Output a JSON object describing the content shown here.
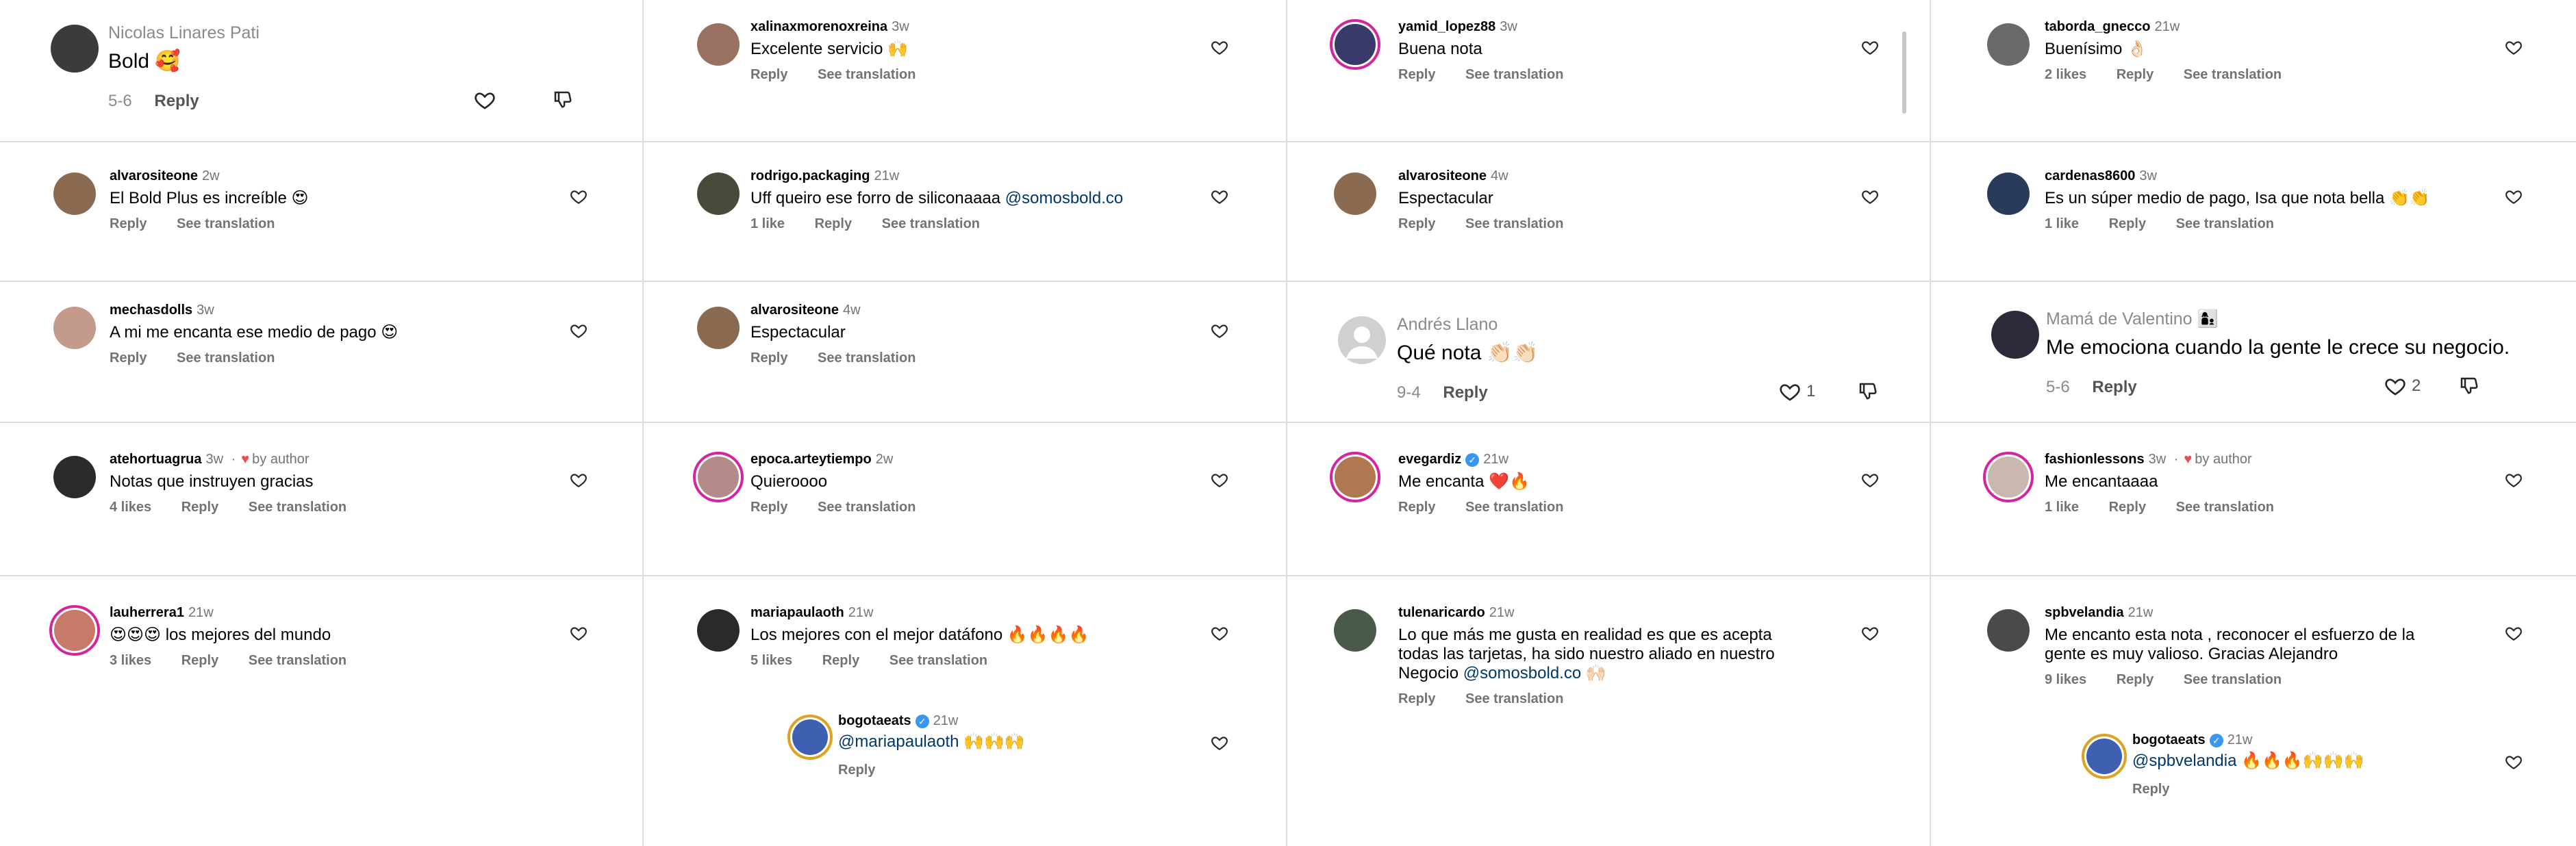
{
  "columns": [
    {
      "comments": [
        {
          "type": "tiktok",
          "name": "Nicolas Linares Pati",
          "text": "Bold 🥰",
          "date": "5-6",
          "reply": "Reply",
          "likes": ""
        },
        {
          "type": "ig",
          "user": "alvarositeone",
          "time": "2w",
          "text": "El Bold Plus es increíble 😍",
          "likes": "",
          "reply": "Reply",
          "translate": "See translation"
        },
        {
          "type": "ig",
          "user": "mechasdolls",
          "time": "3w",
          "text": "A mi me encanta ese medio de pago 😍",
          "likes": "",
          "reply": "Reply",
          "translate": "See translation"
        },
        {
          "type": "ig",
          "user": "atehortuagrua",
          "time": "3w",
          "by_author": "by author",
          "text": "Notas que instruyen gracias",
          "likes": "4 likes",
          "reply": "Reply",
          "translate": "See translation"
        },
        {
          "type": "ig",
          "user": "lauherrera1",
          "time": "21w",
          "text": "😍😍😍 los mejores del mundo",
          "likes": "3 likes",
          "reply": "Reply",
          "translate": "See translation"
        }
      ]
    },
    {
      "comments": [
        {
          "type": "ig",
          "user": "xalinaxmorenoxreina",
          "time": "3w",
          "text": "Excelente servicio 🙌",
          "likes": "",
          "reply": "Reply",
          "translate": "See translation"
        },
        {
          "type": "ig",
          "user": "rodrigo.packaging",
          "time": "21w",
          "text": "Uff queiro ese forro de siliconaaaa",
          "mention": "@somosbold.co",
          "likes": "1 like",
          "reply": "Reply",
          "translate": "See translation"
        },
        {
          "type": "ig",
          "user": "alvarositeone",
          "time": "4w",
          "text": "Espectacular",
          "likes": "",
          "reply": "Reply",
          "translate": "See translation"
        },
        {
          "type": "ig",
          "user": "epoca.arteytiempo",
          "time": "2w",
          "text": "Quieroooo",
          "likes": "",
          "reply": "Reply",
          "translate": "See translation"
        },
        {
          "type": "ig",
          "user": "mariapaulaoth",
          "time": "21w",
          "text": "Los mejores con el mejor datáfono 🔥🔥🔥🔥",
          "likes": "5 likes",
          "reply": "Reply",
          "translate": "See translation",
          "sub": {
            "user": "bogotaeats",
            "time": "21w",
            "mention": "@mariapaulaoth",
            "text": "🙌🙌🙌",
            "reply": "Reply"
          }
        }
      ]
    },
    {
      "comments": [
        {
          "type": "ig",
          "user": "yamid_lopez88",
          "time": "3w",
          "text": "Buena nota",
          "likes": "",
          "reply": "Reply",
          "translate": "See translation"
        },
        {
          "type": "ig",
          "user": "alvarositeone",
          "time": "4w",
          "text": "Espectacular",
          "likes": "",
          "reply": "Reply",
          "translate": "See translation"
        },
        {
          "type": "tiktok",
          "name": "Andrés Llano",
          "text": "Qué nota 👏🏻👏🏻",
          "date": "9-4",
          "reply": "Reply",
          "likes": "1"
        },
        {
          "type": "ig",
          "user": "evegardiz",
          "time": "21w",
          "text": "Me encanta ❤️🔥",
          "likes": "",
          "reply": "Reply",
          "translate": "See translation"
        },
        {
          "type": "ig",
          "user": "tulenaricardo",
          "time": "21w",
          "text_lines": [
            "Lo que más me gusta en realidad es que es acepta",
            "todas las tarjetas, ha sido nuestro aliado en nuestro",
            "Negocio"
          ],
          "mention": "@somosbold.co",
          "tail": "🙌🏻",
          "likes": "",
          "reply": "Reply",
          "translate": "See translation"
        }
      ]
    },
    {
      "comments": [
        {
          "type": "ig",
          "user": "taborda_gnecco",
          "time": "21w",
          "text": "Buenísimo 👌🏻",
          "likes": "2 likes",
          "reply": "Reply",
          "translate": "See translation"
        },
        {
          "type": "ig",
          "user": "cardenas8600",
          "time": "3w",
          "text": "Es un súper medio de pago, Isa que nota bella 👏👏",
          "likes": "1 like",
          "reply": "Reply",
          "translate": "See translation"
        },
        {
          "type": "tiktok",
          "name": "Mamá de Valentino 👩‍👦",
          "text": "Me emociona cuando la gente le crece su negocio.",
          "date": "5-6",
          "reply": "Reply",
          "likes": "2"
        },
        {
          "type": "ig",
          "user": "fashionlessons",
          "time": "3w",
          "by_author": "by author",
          "text": "Me encantaaaa",
          "likes": "1 like",
          "reply": "Reply",
          "translate": "See translation"
        },
        {
          "type": "ig",
          "user": "spbvelandia",
          "time": "21w",
          "text_lines": [
            "Me encanto esta nota , reconocer el esfuerzo de la",
            "gente es muy valioso. Gracias Alejandro"
          ],
          "likes": "9 likes",
          "reply": "Reply",
          "translate": "See translation",
          "sub": {
            "user": "bogotaeats",
            "time": "21w",
            "mention": "@spbvelandia",
            "text": "🔥🔥🔥🙌🙌🙌",
            "reply": "Reply"
          }
        }
      ]
    }
  ],
  "colors": {
    "divider": "#dbdbdb",
    "meta": "#737373",
    "mention": "#00376b",
    "verified": "#3897f0",
    "author_heart": "#ed4956"
  }
}
